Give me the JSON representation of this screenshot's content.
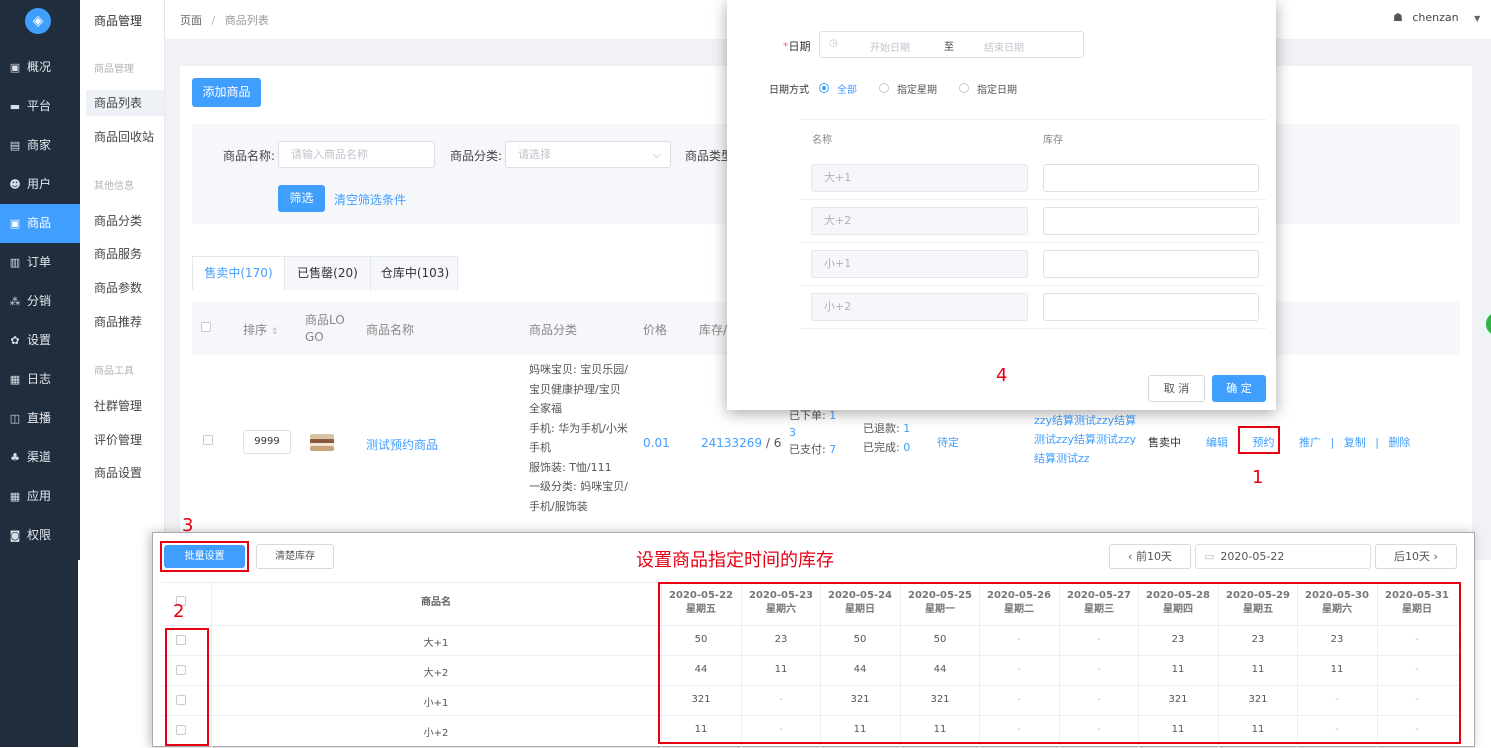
{
  "sidebar": {
    "items": [
      {
        "label": "概况",
        "icon": "monitor-icon",
        "glyph": "▣"
      },
      {
        "label": "平台",
        "icon": "desktop-icon",
        "glyph": "▬"
      },
      {
        "label": "商家",
        "icon": "shop-icon",
        "glyph": "▤"
      },
      {
        "label": "用户",
        "icon": "user-icon",
        "glyph": "☻"
      },
      {
        "label": "商品",
        "icon": "goods-icon",
        "glyph": "▣"
      },
      {
        "label": "订单",
        "icon": "order-icon",
        "glyph": "▥"
      },
      {
        "label": "分销",
        "icon": "distribution-icon",
        "glyph": "⁂"
      },
      {
        "label": "设置",
        "icon": "settings-icon",
        "glyph": "✿"
      },
      {
        "label": "日志",
        "icon": "log-icon",
        "glyph": "▦"
      },
      {
        "label": "直播",
        "icon": "live-icon",
        "glyph": "◫"
      },
      {
        "label": "渠道",
        "icon": "channel-icon",
        "glyph": "♣"
      },
      {
        "label": "应用",
        "icon": "apps-icon",
        "glyph": "▦"
      },
      {
        "label": "权限",
        "icon": "lock-icon",
        "glyph": "◙"
      }
    ]
  },
  "subnav": {
    "title": "商品管理",
    "group1": "商品管理",
    "list": "商品列表",
    "recycle": "商品回收站",
    "group2": "其他信息",
    "category": "商品分类",
    "service": "商品服务",
    "params": "商品参数",
    "recommend": "商品推荐",
    "group3": "商品工具",
    "community": "社群管理",
    "review": "评价管理",
    "settings": "商品设置"
  },
  "topbar": {
    "breadcrumb_root": "页面",
    "breadcrumb_sep": "/",
    "breadcrumb_current": "商品列表",
    "username": "chenzan"
  },
  "main": {
    "add_button": "添加商品",
    "filter": {
      "name_label": "商品名称:",
      "name_placeholder": "请输入商品名称",
      "category_label": "商品分类:",
      "category_placeholder": "请选择",
      "type_label": "商品类型",
      "filter_button": "筛选",
      "clear_link": "清空筛选条件"
    },
    "tabs": [
      "售卖中(170)",
      "已售罄(20)",
      "仓库中(103)"
    ],
    "columns": {
      "sort": "排序",
      "logo": "商品LOGO",
      "name": "商品名称",
      "category": "商品分类",
      "price": "价格",
      "stock": "库存/"
    },
    "row": {
      "sort_value": "9999",
      "name": "测试预约商品",
      "category_lines": [
        "妈咪宝贝: 宝贝乐园/",
        "宝贝健康护理/宝贝",
        "全家福",
        "手机: 华为手机/小米",
        "手机",
        "服饰装: T恤/111",
        "一级分类: 妈咪宝贝/",
        "手机/服饰装"
      ],
      "price": "0.01",
      "stock_link": "24133269",
      "stock_rest": "/ 6",
      "ordered_label": "已下单:",
      "ordered_value": "1",
      "ordered_extra": "3",
      "paid_label": "已支付:",
      "paid_value": "7",
      "refunded_label": "已退款:",
      "refunded_value": "1",
      "done_label": "已完成:",
      "done_value": "0",
      "pending": "待定",
      "settle_lines": [
        "zzy结算测试zzy结算",
        "测试zzy结算测试zzy",
        "结算测试zz"
      ],
      "status": "售卖中",
      "actions": {
        "edit": "编辑",
        "reserve": "预约",
        "promote": "推广",
        "copy": "复制",
        "delete": "删除",
        "sep": "|"
      }
    }
  },
  "modal": {
    "date_label": "日期",
    "required_mark": "*",
    "start_placeholder": "开始日期",
    "to": "至",
    "end_placeholder": "结束日期",
    "date_mode_label": "日期方式",
    "mode_options": [
      "全部",
      "指定星期",
      "指定日期"
    ],
    "col_name": "名称",
    "col_stock": "库存",
    "rows": [
      "大+1",
      "大+2",
      "小+1",
      "小+2"
    ],
    "cancel": "取 消",
    "confirm": "确 定"
  },
  "panel": {
    "batch_button": "批量设置",
    "clear_stock_button": "清楚库存",
    "title": "设置商品指定时间的库存",
    "prev_button": "前10天",
    "date_value": "2020-05-22",
    "next_button": "后10天",
    "col_name": "商品名",
    "dates": [
      {
        "date": "2020-05-22",
        "weekday": "星期五"
      },
      {
        "date": "2020-05-23",
        "weekday": "星期六"
      },
      {
        "date": "2020-05-24",
        "weekday": "星期日"
      },
      {
        "date": "2020-05-25",
        "weekday": "星期一"
      },
      {
        "date": "2020-05-26",
        "weekday": "星期二"
      },
      {
        "date": "2020-05-27",
        "weekday": "星期三"
      },
      {
        "date": "2020-05-28",
        "weekday": "星期四"
      },
      {
        "date": "2020-05-29",
        "weekday": "星期五"
      },
      {
        "date": "2020-05-30",
        "weekday": "星期六"
      },
      {
        "date": "2020-05-31",
        "weekday": "星期日"
      }
    ],
    "rows": [
      {
        "name": "大+1",
        "values": [
          "50",
          "23",
          "50",
          "50",
          "-",
          "-",
          "23",
          "23",
          "23",
          "-"
        ]
      },
      {
        "name": "大+2",
        "values": [
          "44",
          "11",
          "44",
          "44",
          "-",
          "-",
          "11",
          "11",
          "11",
          "-"
        ]
      },
      {
        "name": "小+1",
        "values": [
          "321",
          "-",
          "321",
          "321",
          "-",
          "-",
          "321",
          "321",
          "-",
          "-"
        ]
      },
      {
        "name": "小+2",
        "values": [
          "11",
          "-",
          "11",
          "11",
          "-",
          "-",
          "11",
          "11",
          "-",
          "-"
        ]
      }
    ]
  },
  "annotations": [
    "1",
    "2",
    "3",
    "4"
  ],
  "colors": {
    "accent": "#409eff",
    "sidebar": "#1f2d3d",
    "annotation": "#e60012"
  }
}
